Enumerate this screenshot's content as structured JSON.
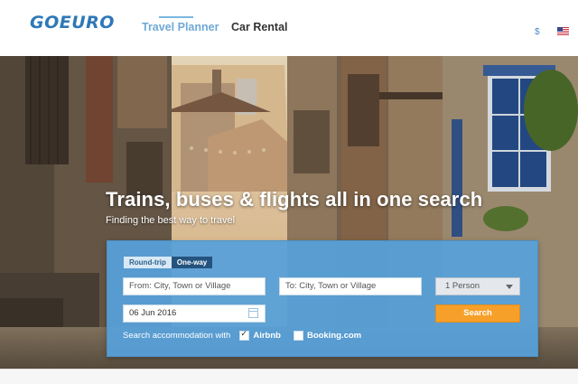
{
  "brand": {
    "logo_text": "GOEURO"
  },
  "nav": {
    "items": [
      {
        "label": "Travel Planner"
      },
      {
        "label": "Car Rental"
      }
    ]
  },
  "header_right": {
    "currency": "$",
    "flag": "us-flag-icon"
  },
  "hero": {
    "headline": "Trains, buses & flights all in one search",
    "subhead": "Finding the best way to travel"
  },
  "search": {
    "tabs": [
      {
        "label": "Round-trip"
      },
      {
        "label": "One-way"
      }
    ],
    "from_placeholder": "From: City, Town or Village",
    "to_placeholder": "To: City, Town or Village",
    "date_value": "06 Jun 2016",
    "passengers_value": "1 Person",
    "submit_label": "Search",
    "accommodation_label": "Search accommodation with",
    "accommodation_options": [
      {
        "label": "Airbnb",
        "checked": true
      },
      {
        "label": "Booking.com",
        "checked": false
      }
    ]
  },
  "colors": {
    "brand_blue": "#2e78b7",
    "panel_blue": "#56a0da",
    "search_orange": "#f6a02a"
  }
}
